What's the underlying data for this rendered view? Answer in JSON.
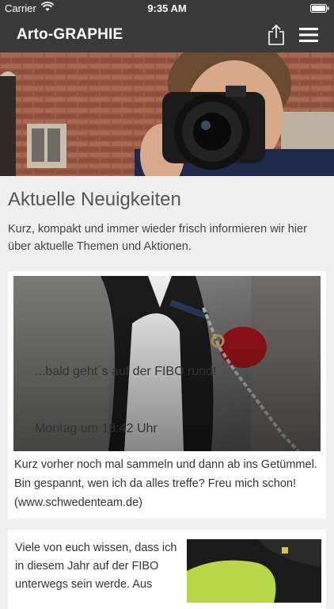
{
  "status_bar": {
    "carrier": "Carrier",
    "time": "9:35 AM"
  },
  "navbar": {
    "title": "Arto-GRAPHIE",
    "share_icon": "share-icon",
    "menu_icon": "hamburger-menu-icon"
  },
  "main": {
    "heading": "Aktuelle Neuigkeiten",
    "intro": "Kurz, kompakt und immer wieder frisch informieren wir hier über aktuelle Themen und Aktionen."
  },
  "posts": [
    {
      "title": "...bald geht´s auf der FIBO rund!",
      "date": "Montag um 18:42 Uhr",
      "excerpt": "Kurz vorher noch mal sammeln und dann ab ins Getümmel. Bin gespannt, wen ich da alles treffe? Freu mich schon! (www.schwedenteam.de)"
    },
    {
      "excerpt": "Viele von euch wissen, dass ich in diesem Jahr auf der FIBO unterwegs sein werde. Aus"
    }
  ],
  "colors": {
    "bar": "#3a3a3a",
    "background": "#efefef",
    "card": "#ffffff"
  }
}
